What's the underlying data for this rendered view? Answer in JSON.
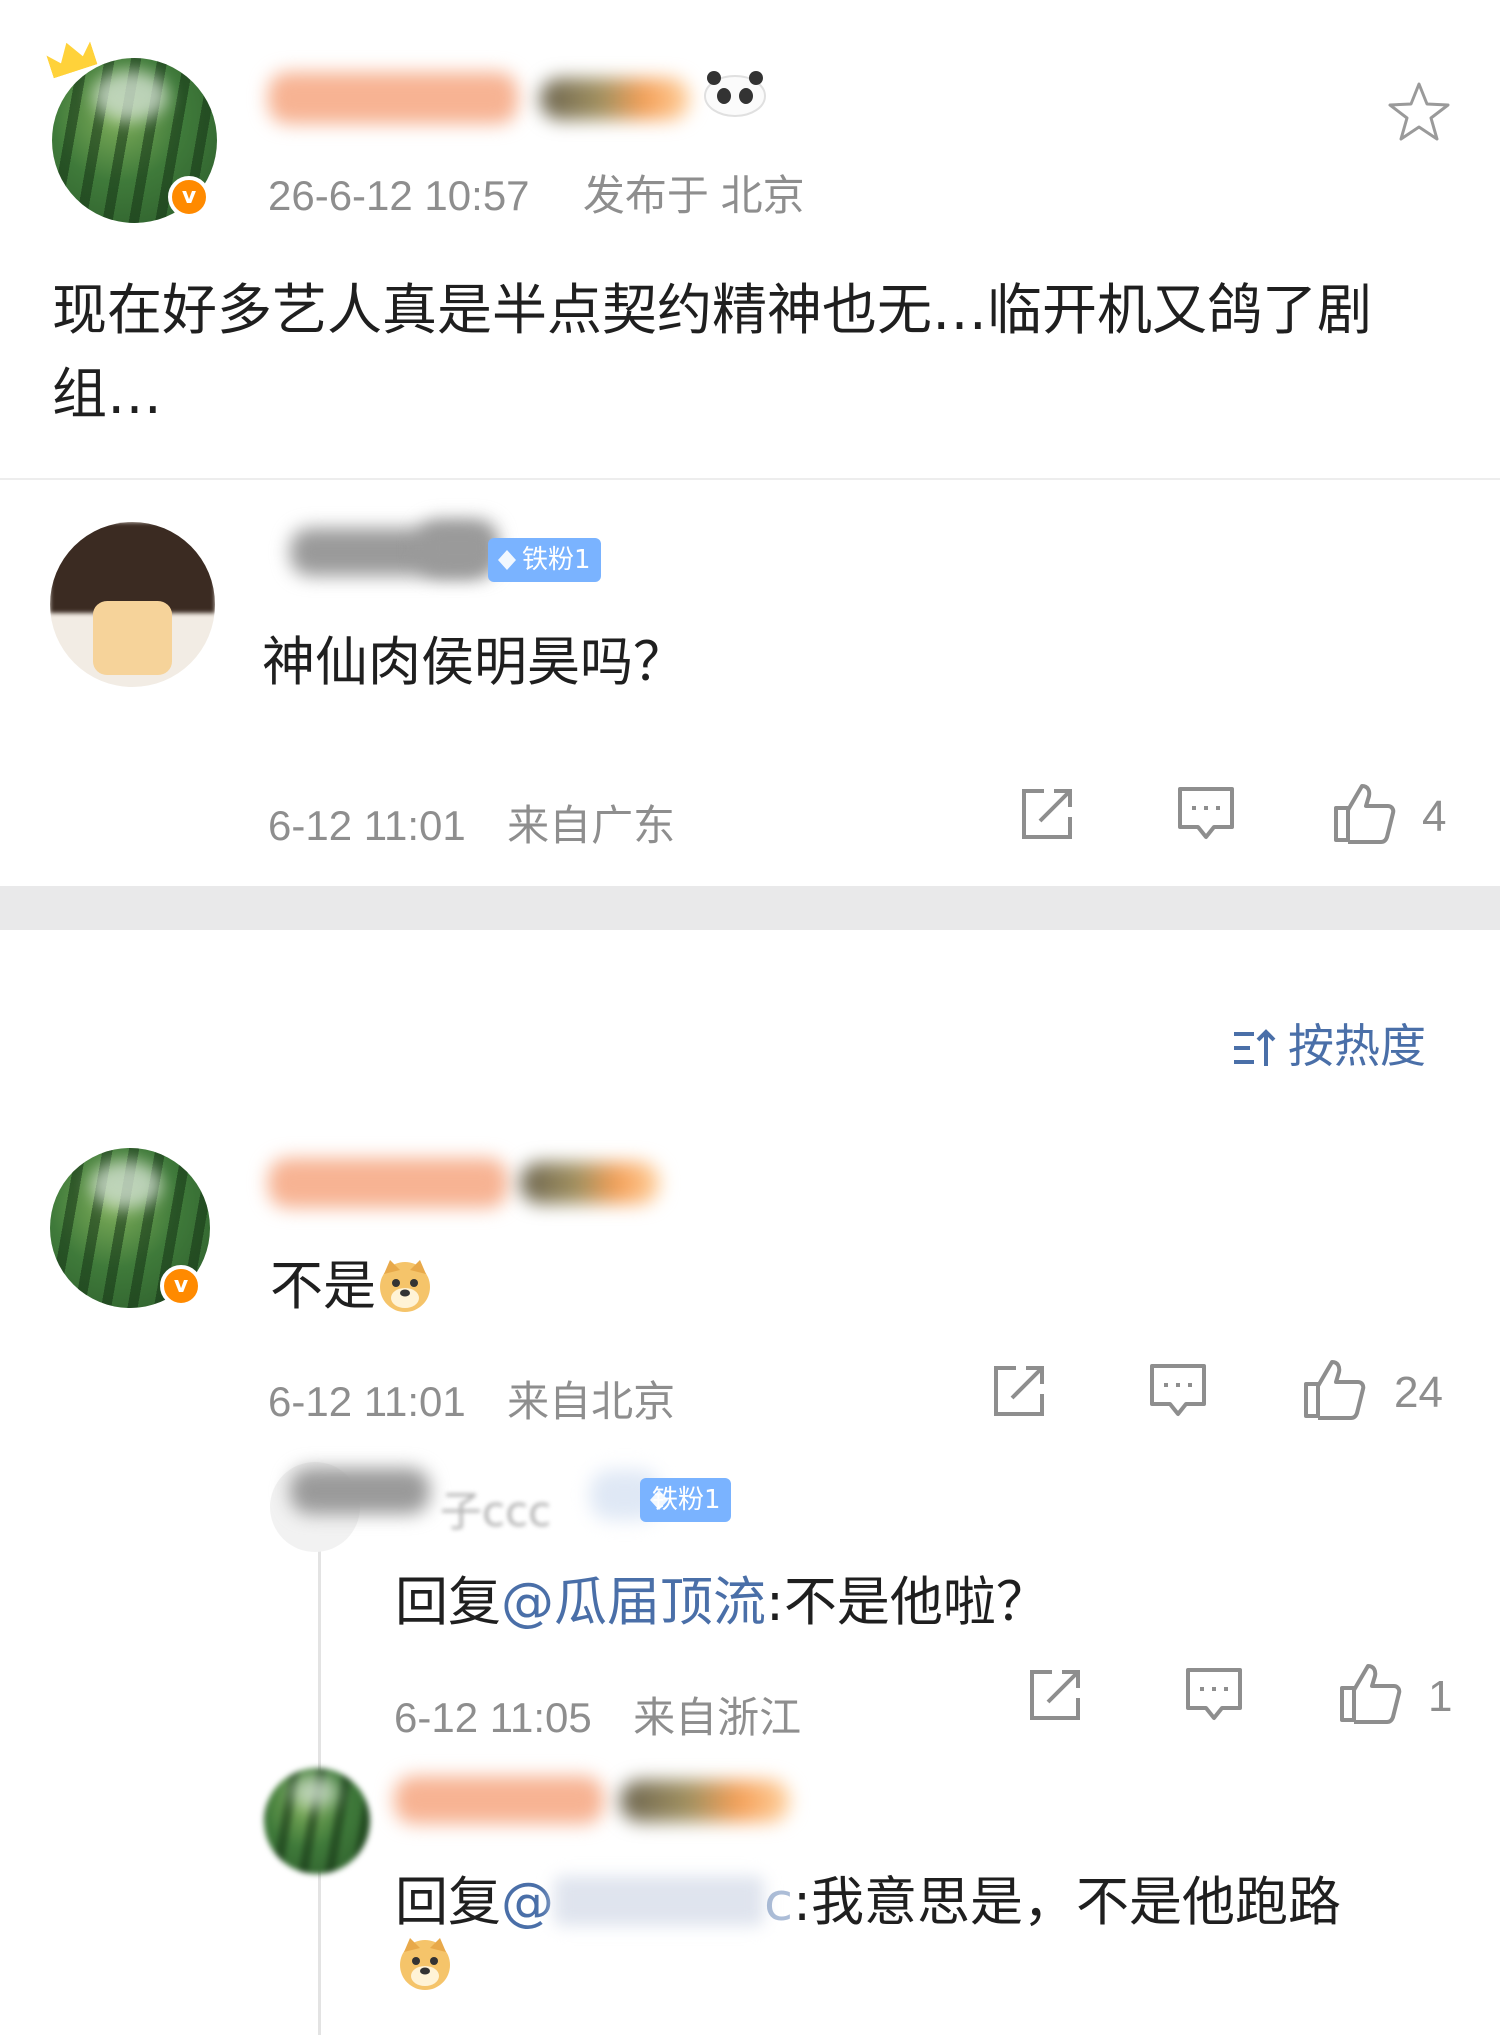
{
  "post": {
    "timestamp": "26-6-12 10:57",
    "location_prefix": "发布于",
    "location": "北京",
    "text": "现在好多艺人真是半点契约精神也无…临开机又鸽了剧组…",
    "star_icon": "star-outline-icon"
  },
  "quoted_comment": {
    "badge": "铁粉1",
    "text": "神仙肉侯明昊吗？",
    "meta_time": "6-12 11:01",
    "meta_location": "来自广东",
    "likes": "4"
  },
  "sort": {
    "label": "按热度",
    "icon": "sort-icon"
  },
  "comments": [
    {
      "text": "不是",
      "emoji": "doge-emoji",
      "meta_time": "6-12 11:01",
      "meta_location": "来自北京",
      "likes": "24"
    }
  ],
  "replies": [
    {
      "name_fragment": "子ccc",
      "badge": "铁粉1",
      "reply_prefix": "回复",
      "mention": "@瓜届顶流",
      "text": ":不是他啦？",
      "meta_time": "6-12 11:05",
      "meta_location": "来自浙江",
      "likes": "1"
    },
    {
      "reply_prefix": "回复",
      "mention_start": "@",
      "mention_end": "c",
      "text": ":我意思是，不是他跑路",
      "emoji": "doge-emoji"
    }
  ],
  "colors": {
    "accent_link": "#4a6fa8",
    "meta_grey": "#8e8e8e",
    "fan_badge": "#7ab3ff",
    "verified_orange": "#ff8a00"
  }
}
